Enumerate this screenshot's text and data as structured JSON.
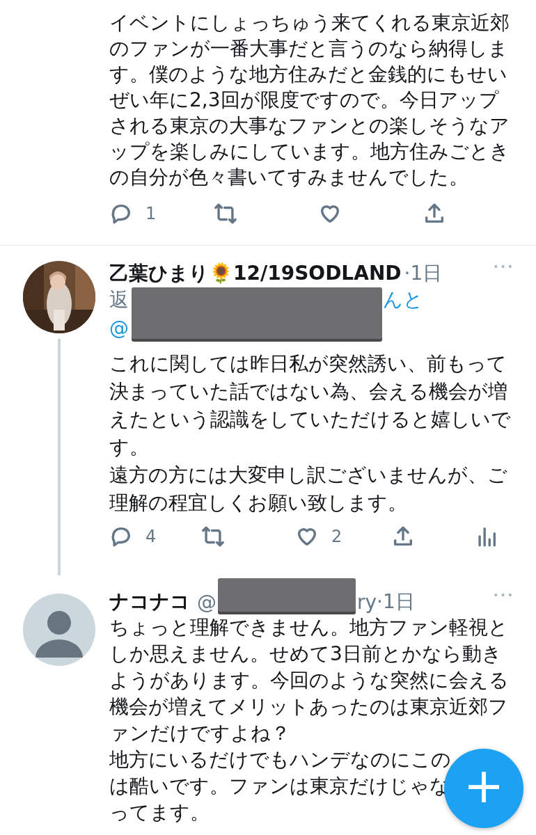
{
  "tweets": [
    {
      "text": [
        "イベントにしょっちゅう来てくれる東京近郊のファンが一番大事だと言うのなら納得します。僕のような地方住みだと金銭的にもせいぜい年に2,3回が限度ですので。今日アップされる東京の大事なファンとの楽しそうなアップを楽しみにしています。地方住みごときの自分が色々書いてすみませんでした。"
      ],
      "actions": {
        "replies": "1"
      }
    },
    {
      "name": "乙葉ひまり🌻12/19SODLAND",
      "time": "·1日",
      "avatar": {
        "kind": "picture"
      },
      "reply_to": {
        "prefix": "返",
        "suffix": "んと"
      },
      "handle": "@",
      "redacted": true,
      "thread_line": true,
      "more": "•••",
      "text": [
        "これに関しては昨日私が突然誘い、前もって決まっていた話ではない為、会える機会が増えたという認識をしていただけると嬉しいです。",
        "遠方の方には大変申し訳ございませんが、ご理解の程宜しくお願い致します。"
      ],
      "actions": {
        "replies": "4",
        "likes": "2",
        "analytics": true
      }
    },
    {
      "name": "ナコナコ",
      "handle": "@",
      "handle_tail": "ry",
      "time": "·1日",
      "avatar": {
        "kind": "default"
      },
      "redacted": true,
      "more": "•••",
      "text": [
        "ちょっと理解できません。地方ファン軽視としか思えません。せめて3日前とかなら動きようがあります。今回のような突然に会える機会が増えてメリットあったのは東京近郊ファンだけですよね？",
        "地方にいるだけでもハンデなのにこの",
        "は酷いです。ファンは東京だけじゃな",
        "ってます。"
      ]
    }
  ],
  "fab": "+"
}
